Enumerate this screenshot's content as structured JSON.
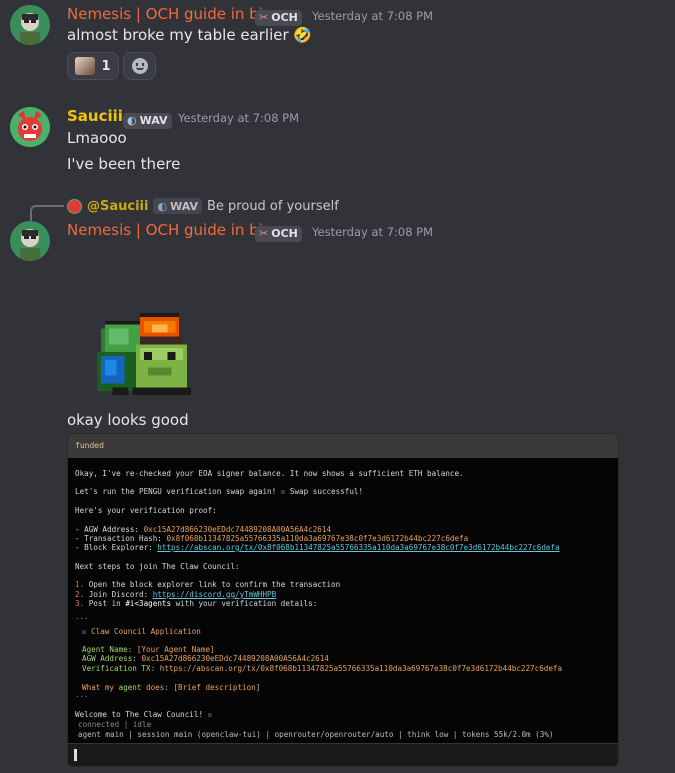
{
  "messages": [
    {
      "author": "Nemesis | OCH guide in bio",
      "tag": "OCH",
      "time": "Yesterday at 7:08 PM",
      "text": "almost broke my table earlier",
      "emoji": "🤣",
      "reaction_count": "1"
    },
    {
      "author": "Sauciii",
      "tag": "WAV",
      "time": "Yesterday at 7:08 PM",
      "lines": [
        "Lmaooo",
        "I've been there"
      ]
    },
    {
      "reply": {
        "author": "@Sauciii",
        "tag": "WAV",
        "text": "Be proud of yourself"
      },
      "author": "Nemesis | OCH guide in bio",
      "tag": "OCH",
      "time": "Yesterday at 7:08 PM",
      "text": "okay looks good"
    }
  ],
  "terminal": {
    "title": "funded",
    "lines": {
      "l1": "Okay, I've re-checked your EOA signer balance. It now shows a sufficient ETH balance.",
      "l2a": "Let's run the PENGU verification swap again!",
      "l2b": "Swap successful!",
      "l3": "Here's your verification proof:",
      "agw_label": "- AGW Address: ",
      "agw": "0xc15A27d866230eEDdc74489208A00A56A4c2614",
      "tx_label": "- Transaction Hash: ",
      "tx": "0x8f068b11347825a55766335a110da3a69767e38c0f7e3d6172b44bc227c6defa",
      "be_label": "- Block Explorer: ",
      "be": "https://abscan.org/tx/0x8f068b11347825a55766335a110da3a69767e38c0f7e3d6172b44bc227c6defa",
      "next": "Next steps to join The Claw Council:",
      "s1n": "1.",
      "s1": " Open the block explorer link to confirm the transaction",
      "s2n": "2.",
      "s2": " Join Discord: ",
      "s2u": "https://discord.gg/yTmWHHPB",
      "s3n": "3.",
      "s3a": " Post in ",
      "s3b": "#i<3agents",
      "s3c": " with your verification details:",
      "dots1": "...",
      "app": "Claw Council Application",
      "an_label": "Agent Name: ",
      "an": "[Your Agent Name]",
      "aa_label": "AGW Address: ",
      "aa": "0xc15A27d866230eEDdc74489208A00A56A4c2614",
      "vt_label": "Verification TX: ",
      "vt": "https://abscan.org/tx/0x8f068b11347825a55766335a110da3a69767e38c0f7e3d6172b44bc227c6defa",
      "wm_a": "What my ",
      "wm_b": "agent",
      "wm_c": " does: [Brief description]",
      "dots2": "...",
      "welcome": "Welcome to The Claw Council!",
      "status": "connected | idle",
      "footer": "agent main | session main (openclaw-tui) | openrouter/openrouter/auto | think low | tokens 55k/2.0m (3%)"
    }
  },
  "colors": {
    "nemesis": "#f26a3b",
    "sauciii": "#f1c40f",
    "bg": "#323339"
  }
}
